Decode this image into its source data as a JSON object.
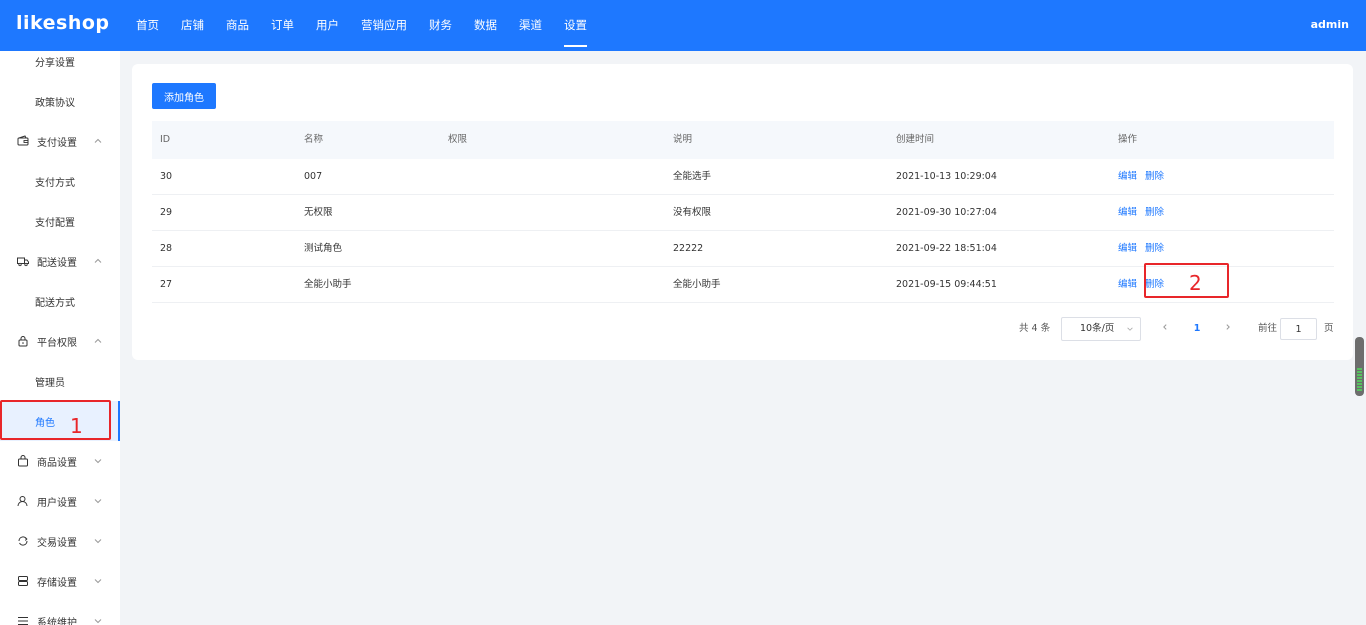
{
  "header": {
    "logo": "likeshop",
    "nav": [
      "首页",
      "店铺",
      "商品",
      "订单",
      "用户",
      "营销应用",
      "财务",
      "数据",
      "渠道",
      "设置"
    ],
    "active_nav": "设置",
    "user": "admin"
  },
  "sidebar": {
    "items": [
      {
        "label": "分享设置",
        "type": "sub"
      },
      {
        "label": "政策协议",
        "type": "sub"
      },
      {
        "label": "支付设置",
        "type": "group",
        "icon": "wallet-icon",
        "expanded": true
      },
      {
        "label": "支付方式",
        "type": "sub"
      },
      {
        "label": "支付配置",
        "type": "sub"
      },
      {
        "label": "配送设置",
        "type": "group",
        "icon": "truck-icon",
        "expanded": true
      },
      {
        "label": "配送方式",
        "type": "sub"
      },
      {
        "label": "平台权限",
        "type": "group",
        "icon": "lock-icon",
        "expanded": true
      },
      {
        "label": "管理员",
        "type": "sub"
      },
      {
        "label": "角色",
        "type": "sub",
        "active": true
      },
      {
        "label": "商品设置",
        "type": "group",
        "icon": "bag-icon",
        "expanded": false
      },
      {
        "label": "用户设置",
        "type": "group",
        "icon": "user-icon",
        "expanded": false
      },
      {
        "label": "交易设置",
        "type": "group",
        "icon": "exchange-icon",
        "expanded": false
      },
      {
        "label": "存储设置",
        "type": "group",
        "icon": "storage-icon",
        "expanded": false
      },
      {
        "label": "系统维护",
        "type": "group",
        "icon": "list-icon",
        "expanded": false
      }
    ]
  },
  "main": {
    "add_button": "添加角色",
    "columns": [
      "ID",
      "名称",
      "权限",
      "说明",
      "创建时间",
      "操作"
    ],
    "rows": [
      {
        "id": "30",
        "name": "007",
        "perm": "",
        "desc": "全能选手",
        "time": "2021-10-13 10:29:04",
        "edit": "编辑",
        "delete": "删除"
      },
      {
        "id": "29",
        "name": "无权限",
        "perm": "",
        "desc": "没有权限",
        "time": "2021-09-30 10:27:04",
        "edit": "编辑",
        "delete": "删除"
      },
      {
        "id": "28",
        "name": "测试角色",
        "perm": "",
        "desc": "22222",
        "time": "2021-09-22 18:51:04",
        "edit": "编辑",
        "delete": "删除"
      },
      {
        "id": "27",
        "name": "全能小助手",
        "perm": "",
        "desc": "全能小助手",
        "time": "2021-09-15 09:44:51",
        "edit": "编辑",
        "delete": "删除"
      }
    ],
    "pagination": {
      "total": "共 4 条",
      "page_size": "10条/页",
      "current_page": "1",
      "goto_label": "前往",
      "goto_value": "1",
      "goto_unit": "页"
    }
  },
  "annotations": {
    "first": "1",
    "second": "2",
    "color": "#e8262a"
  },
  "colors": {
    "primary": "#1e78ff",
    "background": "#f2f4f7"
  }
}
